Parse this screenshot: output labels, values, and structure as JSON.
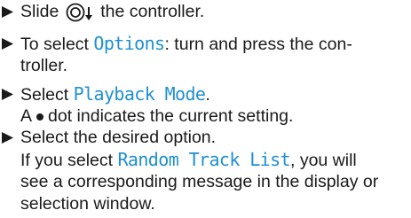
{
  "steps": [
    {
      "slide_pre": "Slide",
      "slide_post": "the controller."
    },
    {
      "select_pre": "To select",
      "select_term": "Options",
      "select_post": ": turn and press the con-",
      "line2": "troller."
    },
    {
      "select_pre": "Select",
      "select_term": "Playback Mode",
      "select_post": ".",
      "note_pre": "A",
      "note_post": "dot indicates the current setting."
    },
    {
      "line1": "Select the desired option.",
      "note_pre": "If you select",
      "note_term": "Random Track List",
      "note_post": ", you will",
      "line3": "see a corresponding message in the display or",
      "line4": "selection window."
    }
  ],
  "colors": {
    "highlight": "#1e8fd0",
    "text": "#1a1a1a"
  },
  "icons": [
    "bullet-triangle-icon",
    "controller-slide-down-icon",
    "filled-dot-icon"
  ]
}
